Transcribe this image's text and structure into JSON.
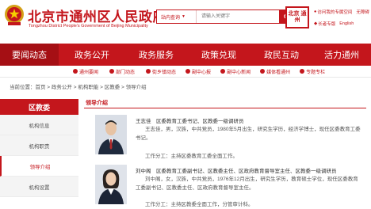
{
  "header": {
    "title": "北京市通州区人民政府",
    "subtitle": "Tongzhou District People's Government of Beijing Municipality",
    "search": {
      "scope": "站内查询",
      "placeholder": "请输入关键字"
    },
    "logo_text": "北京 通州",
    "tools": {
      "mobile": "访问我的专属空间",
      "weibo": "无障碍",
      "wechat": "长者专版",
      "lang": "English"
    }
  },
  "nav": {
    "items": [
      "要闻动态",
      "政务公开",
      "政务服务",
      "政策兑现",
      "政民互动",
      "活力通州"
    ]
  },
  "subnav": {
    "items": [
      "通州要闻",
      "部门动态",
      "街乡镇动态",
      "副中心报",
      "副中心新闻",
      "媒体看通州",
      "专题专栏"
    ]
  },
  "breadcrumb": {
    "label": "当前位置：",
    "path": "首页 > 政务公开 > 机构职能 > 区教委 > 领导介绍"
  },
  "sidebar": {
    "title": "区教委",
    "items": [
      "机构信息",
      "机构职责",
      "领导介绍",
      "机构设置"
    ]
  },
  "main": {
    "title": "领导介绍",
    "leaders": [
      {
        "heading": "王志佳　区委教育工委书记、区教委一级调研员",
        "bio": "王志佳，男，汉族，中共党员，1980年5月出生，研究生学历，经济学博士，现任区委教育工委书记。",
        "duty": "工作分工：主持区委教育工委全面工作。"
      },
      {
        "heading": "刘中阁　区委教育工委副书记、区教委主任、区政府教育督导室主任、区教委一级调研员",
        "bio": "刘中阁，女，汉族，中共党员，1976年12月出生，研究生学历，教育硕士学位，现任区委教育工委副书记、区教委主任、区政府教育督导室主任。",
        "duty": "工作分工：主持区教委全面工作，分管审计科。"
      }
    ]
  },
  "colors": {
    "brand": "#c4161c",
    "nav_active": "#a50f14"
  }
}
